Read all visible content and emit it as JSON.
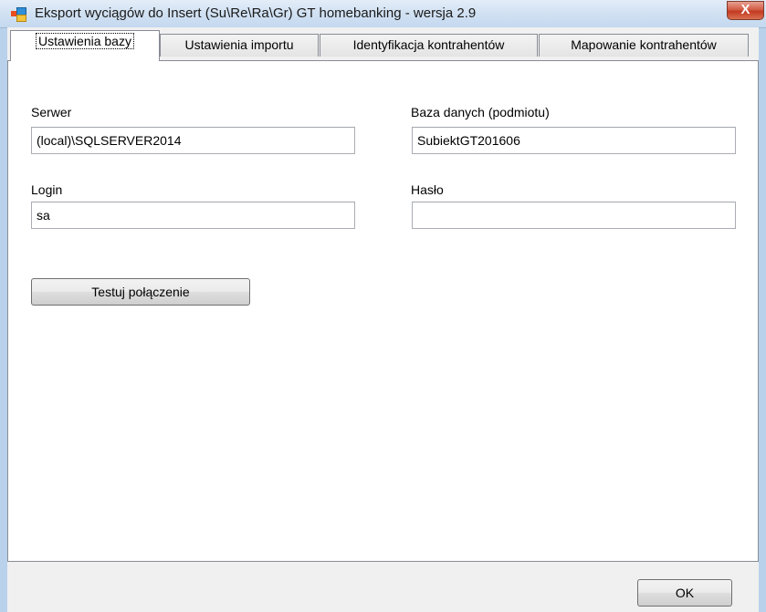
{
  "window": {
    "title": "Eksport wyciągów do Insert (Su\\Re\\Ra\\Gr) GT homebanking - wersja 2.9",
    "close_label": "X"
  },
  "tabs": [
    {
      "label": "Ustawienia bazy",
      "active": true
    },
    {
      "label": "Ustawienia importu",
      "active": false
    },
    {
      "label": "Identyfikacja kontrahentów",
      "active": false
    },
    {
      "label": "Mapowanie kontrahentów",
      "active": false
    }
  ],
  "form": {
    "server": {
      "label": "Serwer",
      "value": "(local)\\SQLSERVER2014"
    },
    "database": {
      "label": "Baza danych (podmiotu)",
      "value": "SubiektGT201606"
    },
    "login": {
      "label": "Login",
      "value": "sa"
    },
    "password": {
      "label": "Hasło",
      "value": ""
    },
    "test_button": "Testuj połączenie"
  },
  "footer": {
    "ok_button": "OK"
  },
  "colors": {
    "titlebar": "#d2e2f3",
    "close_button": "#c23a22",
    "panel": "#ffffff",
    "dialog_bg": "#f0f0f0"
  },
  "icons": {
    "app": "app-window-icon",
    "close": "close-icon"
  }
}
